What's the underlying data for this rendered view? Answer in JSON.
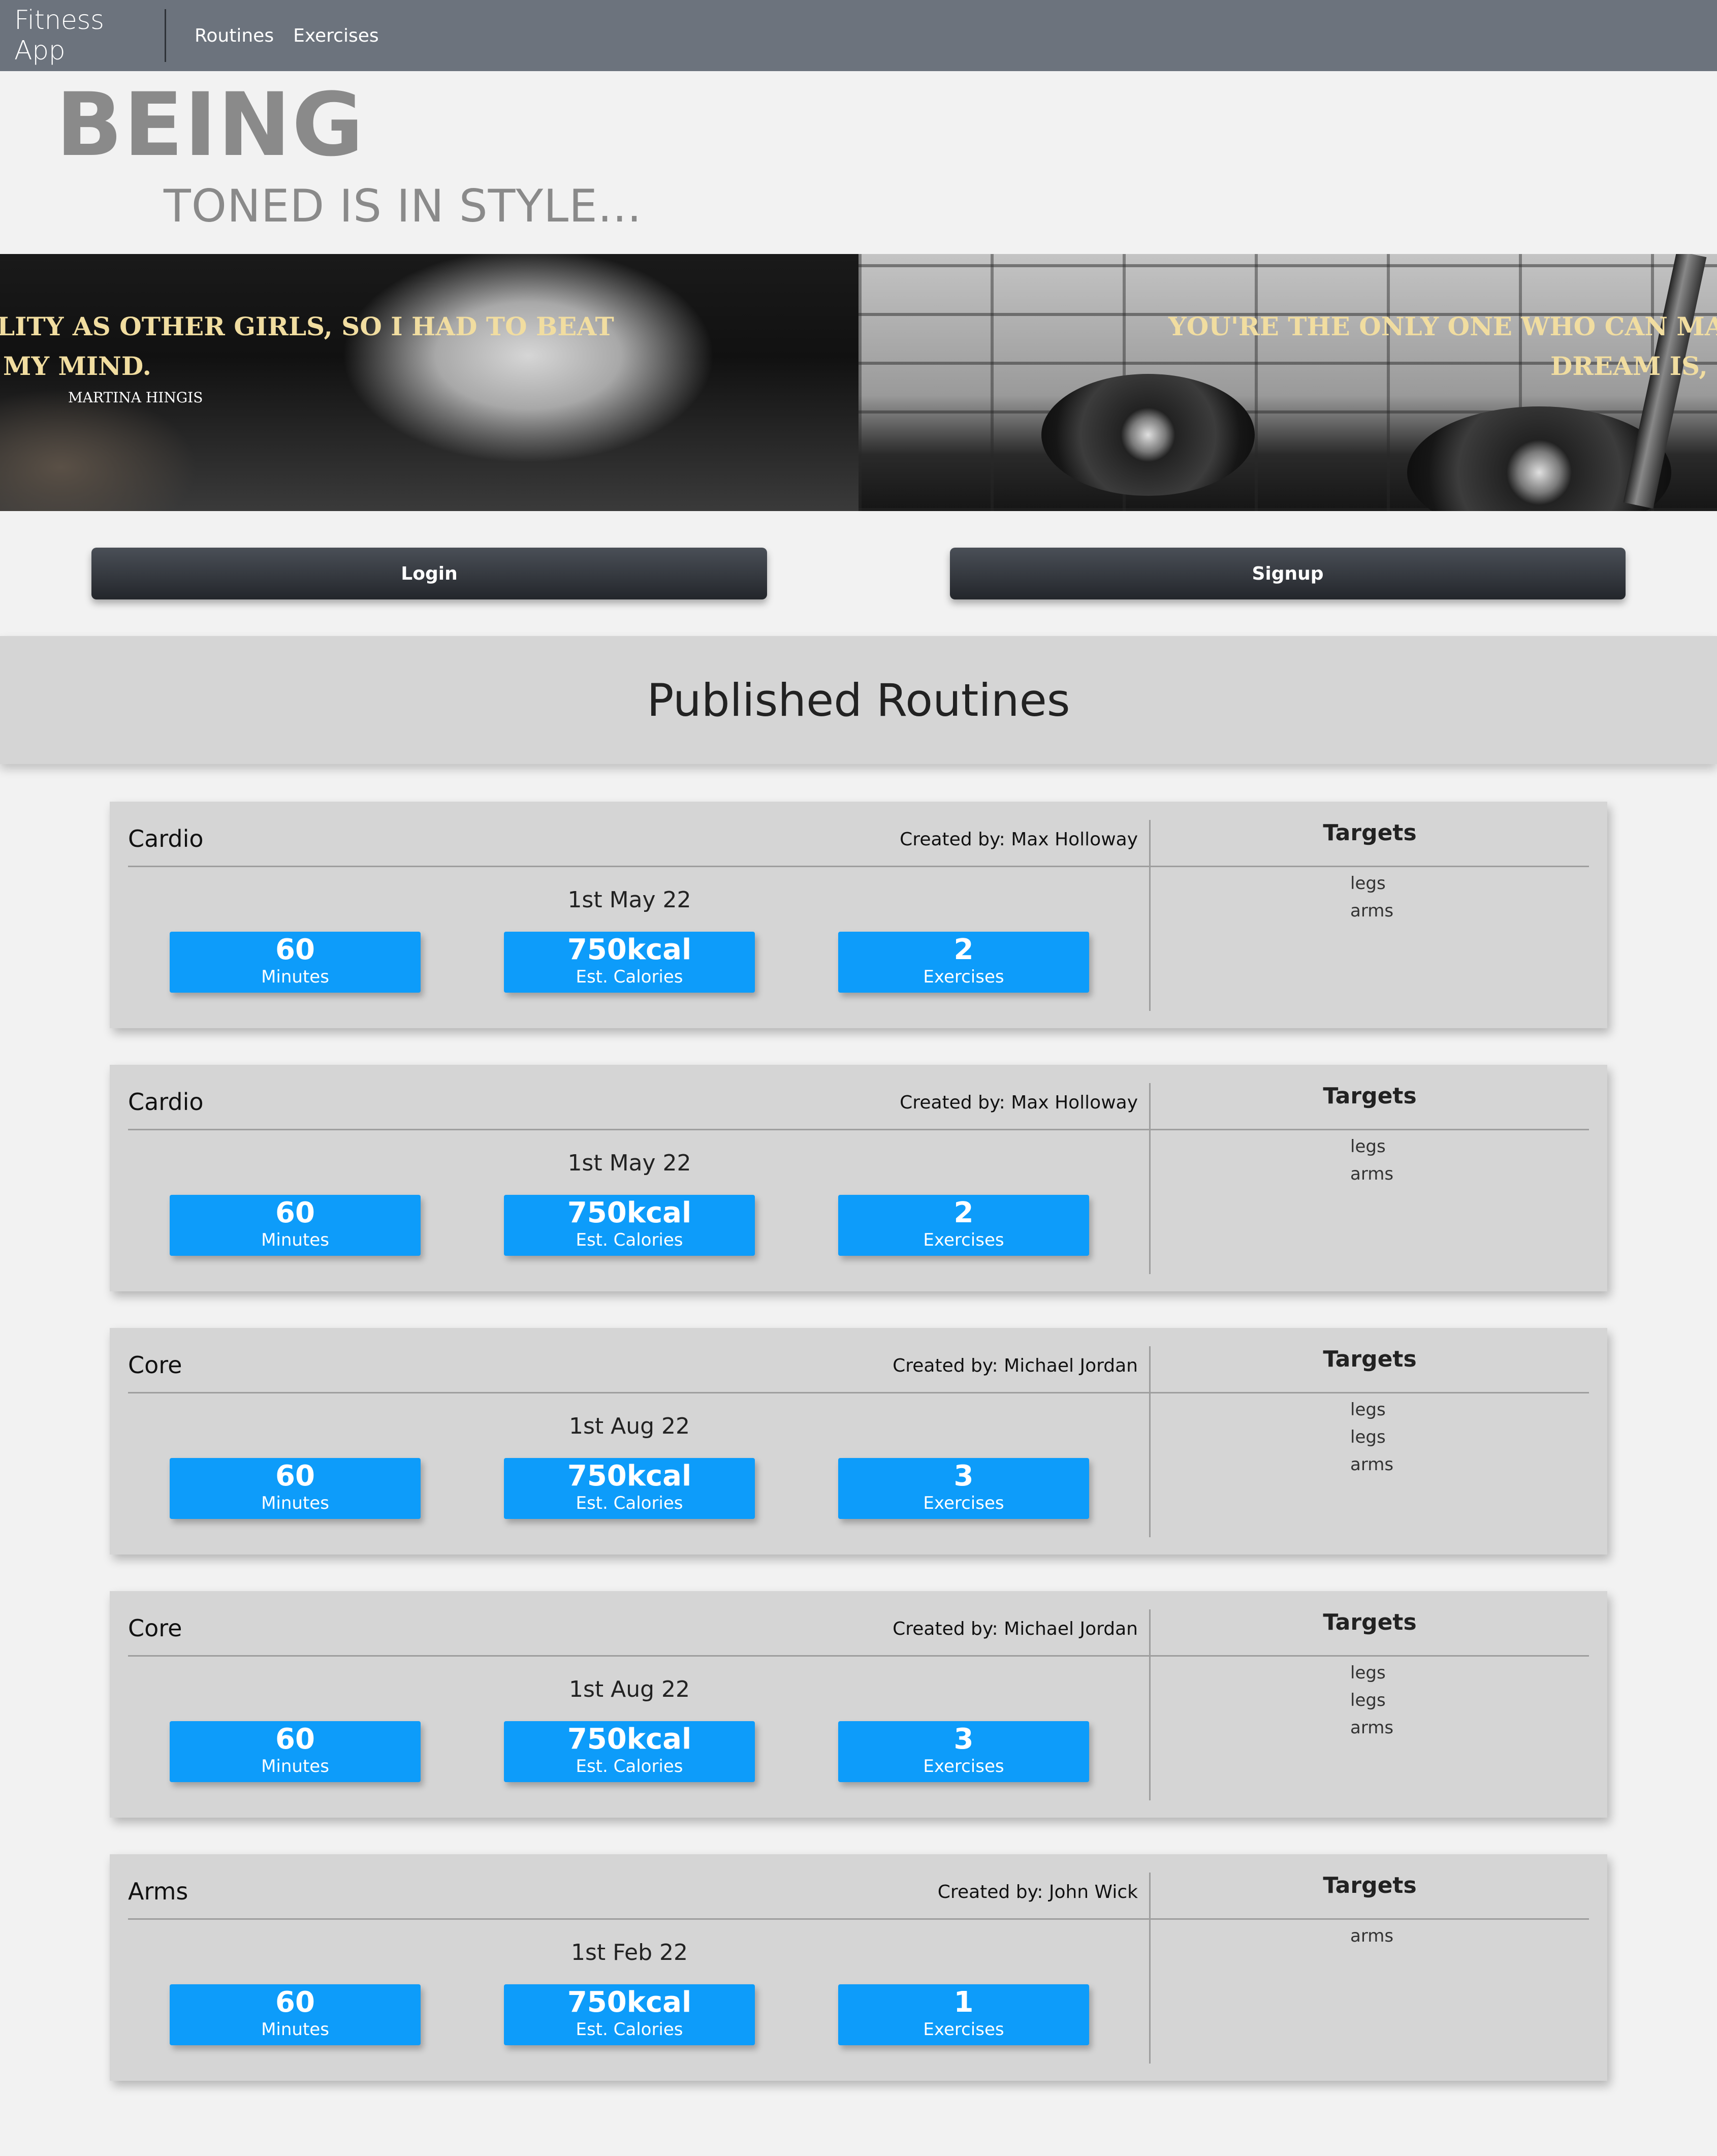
{
  "navbar": {
    "brand": "Fitness App",
    "links": [
      "Routines",
      "Exercises"
    ]
  },
  "hero": {
    "title": "BEING",
    "subtitle": "TONED IS IN STYLE..."
  },
  "banner": {
    "slides": [
      {
        "quote_line_1": "LITY AS OTHER GIRLS, SO I HAD TO BEAT",
        "quote_line_2": "MY MIND.",
        "author": "MARTINA HINGIS"
      },
      {
        "quote_line_1": "YOU'RE THE ONLY ONE WHO CAN MAKE",
        "quote_line_2": "DREAM IS, G"
      }
    ]
  },
  "auth": {
    "login_label": "Login",
    "signup_label": "Signup"
  },
  "section": {
    "title": "Published Routines"
  },
  "routines": [
    {
      "name": "Cardio",
      "created_by": "Created by: Max Holloway",
      "date": "1st May 22",
      "duration": "60",
      "duration_label": "Minutes",
      "calories": "750kcal",
      "calories_label": "Est. Calories",
      "exercises": "2",
      "exercises_label": "Exercises",
      "targets_title": "Targets",
      "targets": [
        "legs",
        "arms"
      ]
    },
    {
      "name": "Cardio",
      "created_by": "Created by: Max Holloway",
      "date": "1st May 22",
      "duration": "60",
      "duration_label": "Minutes",
      "calories": "750kcal",
      "calories_label": "Est. Calories",
      "exercises": "2",
      "exercises_label": "Exercises",
      "targets_title": "Targets",
      "targets": [
        "legs",
        "arms"
      ]
    },
    {
      "name": "Core",
      "created_by": "Created by: Michael Jordan",
      "date": "1st Aug 22",
      "duration": "60",
      "duration_label": "Minutes",
      "calories": "750kcal",
      "calories_label": "Est. Calories",
      "exercises": "3",
      "exercises_label": "Exercises",
      "targets_title": "Targets",
      "targets": [
        "legs",
        "legs",
        "arms"
      ]
    },
    {
      "name": "Core",
      "created_by": "Created by: Michael Jordan",
      "date": "1st Aug 22",
      "duration": "60",
      "duration_label": "Minutes",
      "calories": "750kcal",
      "calories_label": "Est. Calories",
      "exercises": "3",
      "exercises_label": "Exercises",
      "targets_title": "Targets",
      "targets": [
        "legs",
        "legs",
        "arms"
      ]
    },
    {
      "name": "Arms",
      "created_by": "Created by: John Wick",
      "date": "1st Feb 22",
      "duration": "60",
      "duration_label": "Minutes",
      "calories": "750kcal",
      "calories_label": "Est. Calories",
      "exercises": "1",
      "exercises_label": "Exercises",
      "targets_title": "Targets",
      "targets": [
        "arms"
      ]
    }
  ],
  "colors": {
    "navbar": "#6c737d",
    "stat_blue": "#0d9cfa",
    "card_bg": "#d5d5d5",
    "quote_gold": "#f1dda0"
  }
}
